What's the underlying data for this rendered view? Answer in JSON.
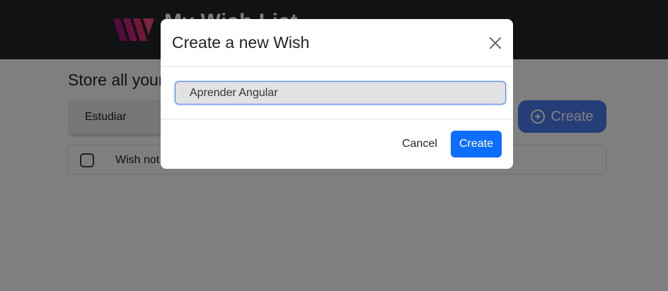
{
  "navbar": {
    "brand": "My Wish List",
    "logo_icon": "brand-logo-icon"
  },
  "page": {
    "subtitle": "Store all your wishes",
    "filter": {
      "selected": "Estudiar"
    },
    "create_button": {
      "label": "Create",
      "icon": "plus-circle-icon"
    },
    "list": [
      {
        "text": "Wish not found",
        "checked": false
      }
    ]
  },
  "modal": {
    "title": "Create a new Wish",
    "close_icon": "close-icon",
    "input": {
      "value": "Aprender Angular"
    },
    "cancel_label": "Cancel",
    "create_label": "Create"
  },
  "colors": {
    "navbar": "#212529",
    "primary": "#0d6efd",
    "backdrop": "rgba(0,0,0,0.5)"
  }
}
